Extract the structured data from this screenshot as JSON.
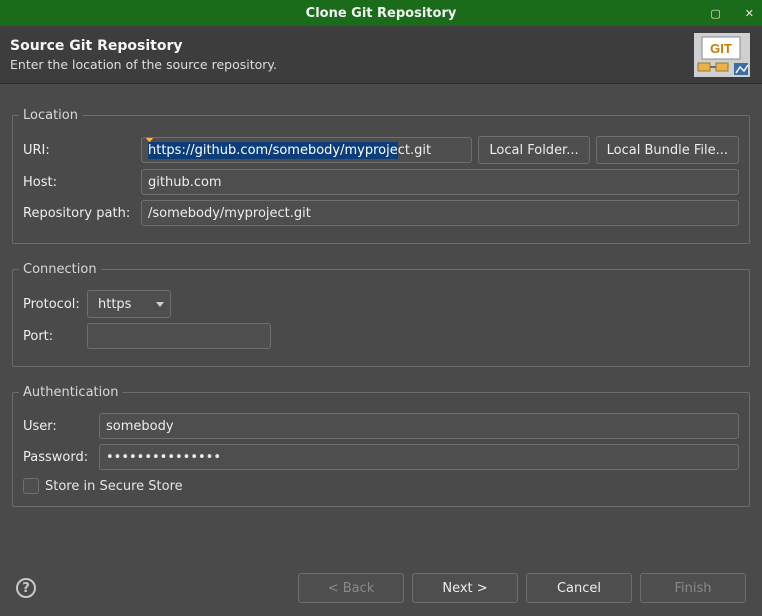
{
  "window": {
    "title": "Clone Git Repository"
  },
  "header": {
    "heading": "Source Git Repository",
    "subtitle": "Enter the location of the source repository.",
    "icon": "git-repo-icon"
  },
  "location": {
    "legend": "Location",
    "uri_label": "URI:",
    "uri_value": "https://github.com/somebody/myproject.git",
    "uri_sel_part": "https://github.com/somebody/myproje",
    "uri_rest_part": "ct.git",
    "local_folder_label": "Local Folder...",
    "local_bundle_label": "Local Bundle File...",
    "host_label": "Host:",
    "host_value": "github.com",
    "repo_path_label": "Repository path:",
    "repo_path_value": "/somebody/myproject.git"
  },
  "connection": {
    "legend": "Connection",
    "protocol_label": "Protocol:",
    "protocol_value": "https",
    "port_label": "Port:",
    "port_value": ""
  },
  "authentication": {
    "legend": "Authentication",
    "user_label": "User:",
    "user_value": "somebody",
    "password_label": "Password:",
    "password_mask": "•••••••••••••••",
    "store_label": "Store in Secure Store",
    "store_checked": false
  },
  "footer": {
    "help_tooltip": "Help",
    "back_label": "< Back",
    "next_label": "Next >",
    "cancel_label": "Cancel",
    "finish_label": "Finish"
  }
}
